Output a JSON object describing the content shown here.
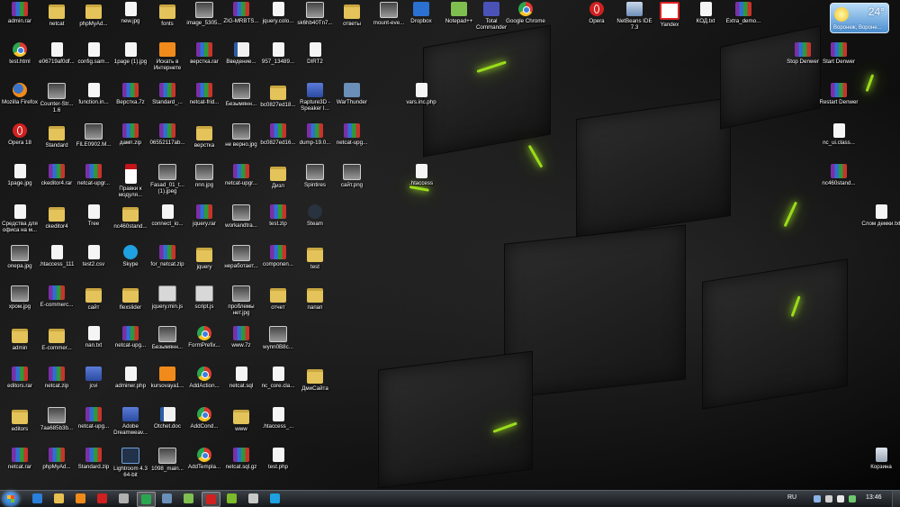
{
  "desktop": {
    "icons": [
      {
        "label": "admin.rar",
        "type": "rar"
      },
      {
        "label": "netcat",
        "type": "folder"
      },
      {
        "label": "phpMyAd...",
        "type": "folder"
      },
      {
        "label": "new.jpg",
        "type": "file"
      },
      {
        "label": "fonts",
        "type": "folder"
      },
      {
        "label": "image_5305...",
        "type": "img"
      },
      {
        "label": "ZIG-MRBTS...",
        "type": "rar"
      },
      {
        "label": "jquery.colo...",
        "type": "file"
      },
      {
        "label": "sk6hb40Tn7...",
        "type": "img"
      },
      {
        "label": "ответы",
        "type": "folder"
      },
      {
        "label": "mount-eve...",
        "type": "img"
      },
      {
        "label": "Dropbox",
        "type": "dropbox"
      },
      {
        "label": "Notepad++",
        "type": "np"
      },
      {
        "label": "Total Commander",
        "type": "disk"
      },
      {
        "label": "Google Chrome",
        "type": "chrome"
      },
      {
        "label": "Opera",
        "type": "opera"
      },
      {
        "label": "NetBeans IDE 7.3",
        "type": "nb"
      },
      {
        "label": "Yandex",
        "type": "yandex"
      },
      {
        "label": "КОД.txt",
        "type": "file"
      },
      {
        "label": "Extra_demo...",
        "type": "rar"
      },
      {
        "label": "test.html",
        "type": "chrome"
      },
      {
        "label": "e06719af0df...",
        "type": "file"
      },
      {
        "label": "config.sam...",
        "type": "file"
      },
      {
        "label": "1page (1).jpg",
        "type": "file"
      },
      {
        "label": "Искать в Интернете",
        "type": "orange"
      },
      {
        "label": "верстка.rar",
        "type": "rar"
      },
      {
        "label": "Введение...",
        "type": "doc"
      },
      {
        "label": "957_13489...",
        "type": "file"
      },
      {
        "label": "DIRT2",
        "type": "file"
      },
      {
        "label": "Stop Denwer",
        "type": "rar"
      },
      {
        "label": "Start Denwer",
        "type": "rar"
      },
      {
        "label": "Mozilla Firefox",
        "type": "ff"
      },
      {
        "label": "Counter-Str... 1.6",
        "type": "img"
      },
      {
        "label": "function.in...",
        "type": "file"
      },
      {
        "label": "Верстка.7z",
        "type": "rar"
      },
      {
        "label": "Standard_...",
        "type": "rar"
      },
      {
        "label": "netcat-frid...",
        "type": "rar"
      },
      {
        "label": "Безымянн...",
        "type": "img"
      },
      {
        "label": "bc0827ed18...",
        "type": "folder"
      },
      {
        "label": "Rapture3D - Speaker I...",
        "type": "exe"
      },
      {
        "label": "WarThunder",
        "type": "wt"
      },
      {
        "label": "vars.inc.php",
        "type": "file"
      },
      {
        "label": "Restart Denwer",
        "type": "rar"
      },
      {
        "label": "Opera 18",
        "type": "opera"
      },
      {
        "label": "Standard",
        "type": "folder"
      },
      {
        "label": "FILE0902.M...",
        "type": "img"
      },
      {
        "label": "дамп.zip",
        "type": "rar"
      },
      {
        "label": "06552117ab...",
        "type": "rar"
      },
      {
        "label": "верстка",
        "type": "folder"
      },
      {
        "label": "не верно.jpg",
        "type": "img"
      },
      {
        "label": "bc0827ed16...",
        "type": "rar"
      },
      {
        "label": "dump-19.0...",
        "type": "rar"
      },
      {
        "label": "netcat-upg...",
        "type": "rar"
      },
      {
        "label": "nc_ui.class...",
        "type": "file"
      },
      {
        "label": "1page.jpg",
        "type": "file"
      },
      {
        "label": "ckeditor4.rar",
        "type": "rar"
      },
      {
        "label": "netcat-upgr...",
        "type": "rar"
      },
      {
        "label": "Правки к модуля...",
        "type": "pdf"
      },
      {
        "label": "Fasad_01_t... (1).jpeg",
        "type": "img"
      },
      {
        "label": "nnn.jpg",
        "type": "img"
      },
      {
        "label": "netcat-upgr...",
        "type": "rar"
      },
      {
        "label": "Дизл",
        "type": "folder"
      },
      {
        "label": "Spintires",
        "type": "img"
      },
      {
        "label": "сайт.png",
        "type": "img"
      },
      {
        "label": ".htaccess",
        "type": "file"
      },
      {
        "label": "nc460stand...",
        "type": "rar"
      },
      {
        "label": "Средства для офиса на м...",
        "type": "file"
      },
      {
        "label": "ckeditor4",
        "type": "folder"
      },
      {
        "label": "Tree",
        "type": "file"
      },
      {
        "label": "nc460stand...",
        "type": "folder"
      },
      {
        "label": "connect_io...",
        "type": "file"
      },
      {
        "label": "jquery.rar",
        "type": "rar"
      },
      {
        "label": "workandtra...",
        "type": "img"
      },
      {
        "label": "test.zip",
        "type": "rar"
      },
      {
        "label": "Steam",
        "type": "steam"
      },
      {
        "label": "Слом демки.txt",
        "type": "file"
      },
      {
        "label": "onepa.jpg",
        "type": "img"
      },
      {
        "label": ".htaccess_111",
        "type": "file"
      },
      {
        "label": "test2.csv",
        "type": "file"
      },
      {
        "label": "Skype",
        "type": "skype"
      },
      {
        "label": "for_netcat.zip",
        "type": "rar"
      },
      {
        "label": "jquery",
        "type": "folder"
      },
      {
        "label": "неработает...",
        "type": "img"
      },
      {
        "label": "componen...",
        "type": "rar"
      },
      {
        "label": "test",
        "type": "folder"
      },
      {
        "label": "хром.jpg",
        "type": "img"
      },
      {
        "label": "E-commerc...",
        "type": "rar"
      },
      {
        "label": "сайт",
        "type": "folder"
      },
      {
        "label": "flexslider",
        "type": "folder"
      },
      {
        "label": "jquery.min.js",
        "type": "java"
      },
      {
        "label": "script.js",
        "type": "java"
      },
      {
        "label": "проблемы нет.jpg",
        "type": "img"
      },
      {
        "label": "отчет",
        "type": "folder"
      },
      {
        "label": "папап",
        "type": "folder"
      },
      {
        "label": "admin",
        "type": "folder"
      },
      {
        "label": "E-commer...",
        "type": "folder"
      },
      {
        "label": "nan.txt",
        "type": "file"
      },
      {
        "label": "netcat-upg...",
        "type": "rar"
      },
      {
        "label": "Безымянн...",
        "type": "img"
      },
      {
        "label": "FormPrefix...",
        "type": "chrome"
      },
      {
        "label": "www.7z",
        "type": "rar"
      },
      {
        "label": "wynn0B8c...",
        "type": "img"
      },
      {
        "label": "editors.rar",
        "type": "rar"
      },
      {
        "label": "netcat.zip",
        "type": "rar"
      },
      {
        "label": "jcvi",
        "type": "exe"
      },
      {
        "label": "adminer.php",
        "type": "file"
      },
      {
        "label": "kursovaya1...",
        "type": "orange"
      },
      {
        "label": "AddAction...",
        "type": "chrome"
      },
      {
        "label": "netcat.sql",
        "type": "file"
      },
      {
        "label": "nc_core.cla...",
        "type": "file"
      },
      {
        "label": "ДмиСайта",
        "type": "folder"
      },
      {
        "label": "editors",
        "type": "folder"
      },
      {
        "label": "7aa685b3b...",
        "type": "img"
      },
      {
        "label": "netcat-upg...",
        "type": "rar"
      },
      {
        "label": "Adobe Dreamweav...",
        "type": "exe"
      },
      {
        "label": "Otchet.doc",
        "type": "doc"
      },
      {
        "label": "AddCond...",
        "type": "chrome"
      },
      {
        "label": "www",
        "type": "folder"
      },
      {
        "label": ".htaccess_...",
        "type": "file"
      },
      {
        "label": "netcat.rar",
        "type": "rar"
      },
      {
        "label": "phpMyAd...",
        "type": "rar"
      },
      {
        "label": "Standard.zip",
        "type": "rar"
      },
      {
        "label": "Lightroom 4.3 64-bit",
        "type": "lr"
      },
      {
        "label": "1098_main...",
        "type": "img"
      },
      {
        "label": "AddTempla...",
        "type": "chrome"
      },
      {
        "label": "netcat.sql.gz",
        "type": "rar"
      },
      {
        "label": "test.php",
        "type": "file"
      },
      {
        "label": "Корзина",
        "type": "bin"
      }
    ]
  },
  "weather": {
    "temp": "24°",
    "city": "Воронеж, Вороне..."
  },
  "taskbar": {
    "apps": [
      "ie",
      "explorer",
      "media",
      "opera",
      "cd",
      "chrome",
      "win",
      "net",
      "opera2",
      "utorrent",
      "tool",
      "skype"
    ],
    "language": "RU",
    "clock": "13:46"
  }
}
